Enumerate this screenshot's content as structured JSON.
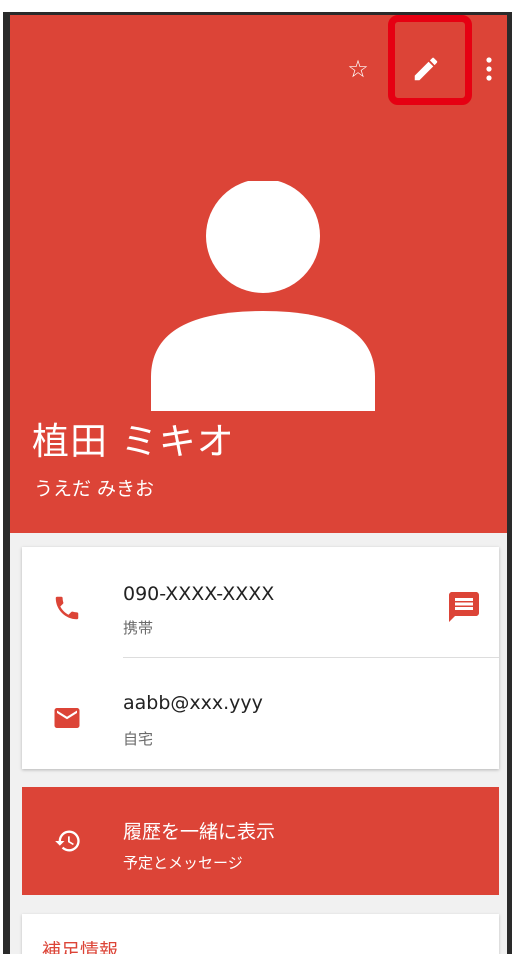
{
  "contact": {
    "name": "植田 ミキオ",
    "reading": "うえだ みきお"
  },
  "toolbar": {
    "icons": [
      "star-outline-icon",
      "edit-pencil-icon",
      "more-vert-icon"
    ]
  },
  "details": {
    "phone": {
      "number": "090-XXXX-XXXX",
      "type": "携帯"
    },
    "email": {
      "address": "aabb@xxx.yyy",
      "type": "自宅"
    }
  },
  "history": {
    "title": "履歴を一緒に表示",
    "subtitle": "予定とメッセージ"
  },
  "extra": {
    "title": "補足情報"
  },
  "colors": {
    "accent": "#dc4437",
    "highlight": "#e60012"
  }
}
